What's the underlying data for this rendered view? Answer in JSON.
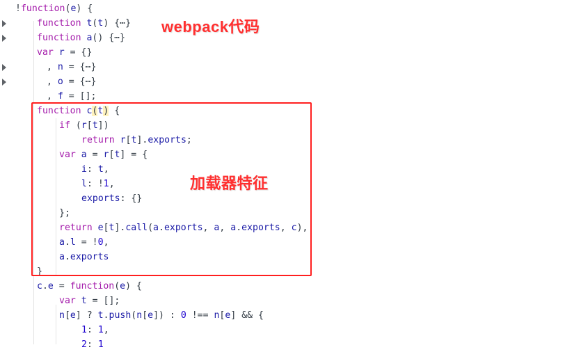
{
  "colors": {
    "keyword": "#a41bab",
    "identifier": "#1a1aa6",
    "plain": "#303942",
    "number": "#1c00cf",
    "bracket_match": "#fff2bd",
    "highlight_box": "#ff1f1f",
    "annotation": "#ff2f2f"
  },
  "annotations": {
    "title": "webpack代码",
    "loader": "加载器特征"
  },
  "code_lines": [
    {
      "tokens": [
        [
          "pl",
          "!"
        ],
        [
          "kw",
          "function"
        ],
        [
          "pl",
          "("
        ],
        [
          "id",
          "e"
        ],
        [
          "pl",
          ") {"
        ]
      ],
      "arrow": false
    },
    {
      "tokens": [
        [
          "kw",
          "function "
        ],
        [
          "id",
          "t"
        ],
        [
          "pl",
          "("
        ],
        [
          "id",
          "t"
        ],
        [
          "pl",
          ") {⋯}"
        ]
      ],
      "arrow": true
    },
    {
      "tokens": [
        [
          "kw",
          "function "
        ],
        [
          "id",
          "a"
        ],
        [
          "pl",
          "() {⋯}"
        ]
      ],
      "arrow": true
    },
    {
      "tokens": [
        [
          "kw",
          "var "
        ],
        [
          "id",
          "r"
        ],
        [
          "pl",
          " = {}"
        ]
      ],
      "arrow": false
    },
    {
      "tokens": [
        [
          "pl",
          ", "
        ],
        [
          "id",
          "n"
        ],
        [
          "pl",
          " = {⋯}"
        ]
      ],
      "arrow": true
    },
    {
      "tokens": [
        [
          "pl",
          ", "
        ],
        [
          "id",
          "o"
        ],
        [
          "pl",
          " = {⋯}"
        ]
      ],
      "arrow": true
    },
    {
      "tokens": [
        [
          "pl",
          ", "
        ],
        [
          "id",
          "f"
        ],
        [
          "pl",
          " = [];"
        ]
      ],
      "arrow": false
    },
    {
      "tokens": [
        [
          "kw",
          "function "
        ],
        [
          "id",
          "c"
        ],
        [
          "br",
          "("
        ],
        [
          "id",
          "t"
        ],
        [
          "br",
          ")"
        ],
        [
          "pl",
          " {"
        ]
      ],
      "arrow": false
    },
    {
      "tokens": [
        [
          "kw",
          "if "
        ],
        [
          "pl",
          "("
        ],
        [
          "id",
          "r"
        ],
        [
          "pl",
          "["
        ],
        [
          "id",
          "t"
        ],
        [
          "pl",
          "])"
        ]
      ],
      "arrow": false
    },
    {
      "tokens": [
        [
          "kw",
          "return "
        ],
        [
          "id",
          "r"
        ],
        [
          "pl",
          "["
        ],
        [
          "id",
          "t"
        ],
        [
          "pl",
          "]."
        ],
        [
          "id",
          "exports"
        ],
        [
          "pl",
          ";"
        ]
      ],
      "arrow": false
    },
    {
      "tokens": [
        [
          "kw",
          "var "
        ],
        [
          "id",
          "a"
        ],
        [
          "pl",
          " = "
        ],
        [
          "id",
          "r"
        ],
        [
          "pl",
          "["
        ],
        [
          "id",
          "t"
        ],
        [
          "pl",
          "] = {"
        ]
      ],
      "arrow": false
    },
    {
      "tokens": [
        [
          "id",
          "i"
        ],
        [
          "pl",
          ": "
        ],
        [
          "id",
          "t"
        ],
        [
          "pl",
          ","
        ]
      ],
      "arrow": false
    },
    {
      "tokens": [
        [
          "id",
          "l"
        ],
        [
          "pl",
          ": !"
        ],
        [
          "num",
          "1"
        ],
        [
          "pl",
          ","
        ]
      ],
      "arrow": false
    },
    {
      "tokens": [
        [
          "id",
          "exports"
        ],
        [
          "pl",
          ": {}"
        ]
      ],
      "arrow": false
    },
    {
      "tokens": [
        [
          "pl",
          "};"
        ]
      ],
      "arrow": false
    },
    {
      "tokens": [
        [
          "kw",
          "return "
        ],
        [
          "id",
          "e"
        ],
        [
          "pl",
          "["
        ],
        [
          "id",
          "t"
        ],
        [
          "pl",
          "]."
        ],
        [
          "id",
          "call"
        ],
        [
          "pl",
          "("
        ],
        [
          "id",
          "a"
        ],
        [
          "pl",
          "."
        ],
        [
          "id",
          "exports"
        ],
        [
          "pl",
          ", "
        ],
        [
          "id",
          "a"
        ],
        [
          "pl",
          ", "
        ],
        [
          "id",
          "a"
        ],
        [
          "pl",
          "."
        ],
        [
          "id",
          "exports"
        ],
        [
          "pl",
          ", "
        ],
        [
          "id",
          "c"
        ],
        [
          "pl",
          "),"
        ]
      ],
      "arrow": false
    },
    {
      "tokens": [
        [
          "id",
          "a"
        ],
        [
          "pl",
          "."
        ],
        [
          "id",
          "l"
        ],
        [
          "pl",
          " = !"
        ],
        [
          "num",
          "0"
        ],
        [
          "pl",
          ","
        ]
      ],
      "arrow": false
    },
    {
      "tokens": [
        [
          "id",
          "a"
        ],
        [
          "pl",
          "."
        ],
        [
          "id",
          "exports"
        ]
      ],
      "arrow": false
    },
    {
      "tokens": [
        [
          "pl",
          "}"
        ]
      ],
      "arrow": false
    },
    {
      "tokens": [
        [
          "id",
          "c"
        ],
        [
          "pl",
          "."
        ],
        [
          "id",
          "e"
        ],
        [
          "pl",
          " = "
        ],
        [
          "kw",
          "function"
        ],
        [
          "pl",
          "("
        ],
        [
          "id",
          "e"
        ],
        [
          "pl",
          ") {"
        ]
      ],
      "arrow": false
    },
    {
      "tokens": [
        [
          "kw",
          "var "
        ],
        [
          "id",
          "t"
        ],
        [
          "pl",
          " = [];"
        ]
      ],
      "arrow": false
    },
    {
      "tokens": [
        [
          "id",
          "n"
        ],
        [
          "pl",
          "["
        ],
        [
          "id",
          "e"
        ],
        [
          "pl",
          "] ? "
        ],
        [
          "id",
          "t"
        ],
        [
          "pl",
          "."
        ],
        [
          "id",
          "push"
        ],
        [
          "pl",
          "("
        ],
        [
          "id",
          "n"
        ],
        [
          "pl",
          "["
        ],
        [
          "id",
          "e"
        ],
        [
          "pl",
          "]) : "
        ],
        [
          "num",
          "0"
        ],
        [
          "pl",
          " !== "
        ],
        [
          "id",
          "n"
        ],
        [
          "pl",
          "["
        ],
        [
          "id",
          "e"
        ],
        [
          "pl",
          "] && {"
        ]
      ],
      "arrow": false
    },
    {
      "tokens": [
        [
          "num",
          "1"
        ],
        [
          "pl",
          ": "
        ],
        [
          "num",
          "1"
        ],
        [
          "pl",
          ","
        ]
      ],
      "arrow": false
    },
    {
      "tokens": [
        [
          "num",
          "2"
        ],
        [
          "pl",
          ": "
        ],
        [
          "num",
          "1"
        ]
      ],
      "arrow": false
    }
  ]
}
